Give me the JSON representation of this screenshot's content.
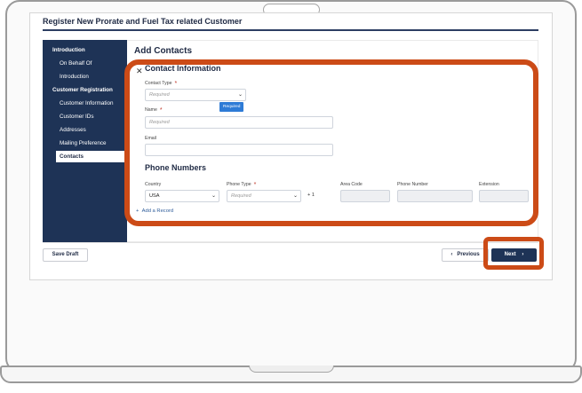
{
  "app": {
    "title": "Register New Prorate and Fuel Tax related Customer"
  },
  "sidebar": {
    "sections": [
      {
        "label": "Introduction",
        "items": [
          "On Behalf Of",
          "Introduction"
        ]
      },
      {
        "label": "Customer Registration",
        "items": [
          "Customer Information",
          "Customer IDs",
          "Addresses",
          "Mailing Preference",
          "Contacts"
        ]
      }
    ],
    "active": "Contacts"
  },
  "page": {
    "title": "Add Contacts"
  },
  "contact": {
    "title": "Contact Information",
    "contact_type": {
      "label": "Contact Type",
      "placeholder": "Required",
      "required_badge": "Required"
    },
    "name": {
      "label": "Name",
      "placeholder": "Required"
    },
    "email": {
      "label": "Email",
      "value": ""
    }
  },
  "phone": {
    "title": "Phone Numbers",
    "country": {
      "label": "Country",
      "value": "USA"
    },
    "phone_type": {
      "label": "Phone Type",
      "placeholder": "Required"
    },
    "dial_code": "+ 1",
    "area_code": {
      "label": "Area Code"
    },
    "phone_number": {
      "label": "Phone Number"
    },
    "extension": {
      "label": "Extension"
    },
    "add_record": "Add a Record"
  },
  "footer": {
    "save_draft": "Save Draft",
    "previous": "Previous",
    "next": "Next"
  },
  "colors": {
    "sidebar": "#1e3356",
    "highlight": "#cc4b17",
    "badge": "#2e7bd6"
  }
}
